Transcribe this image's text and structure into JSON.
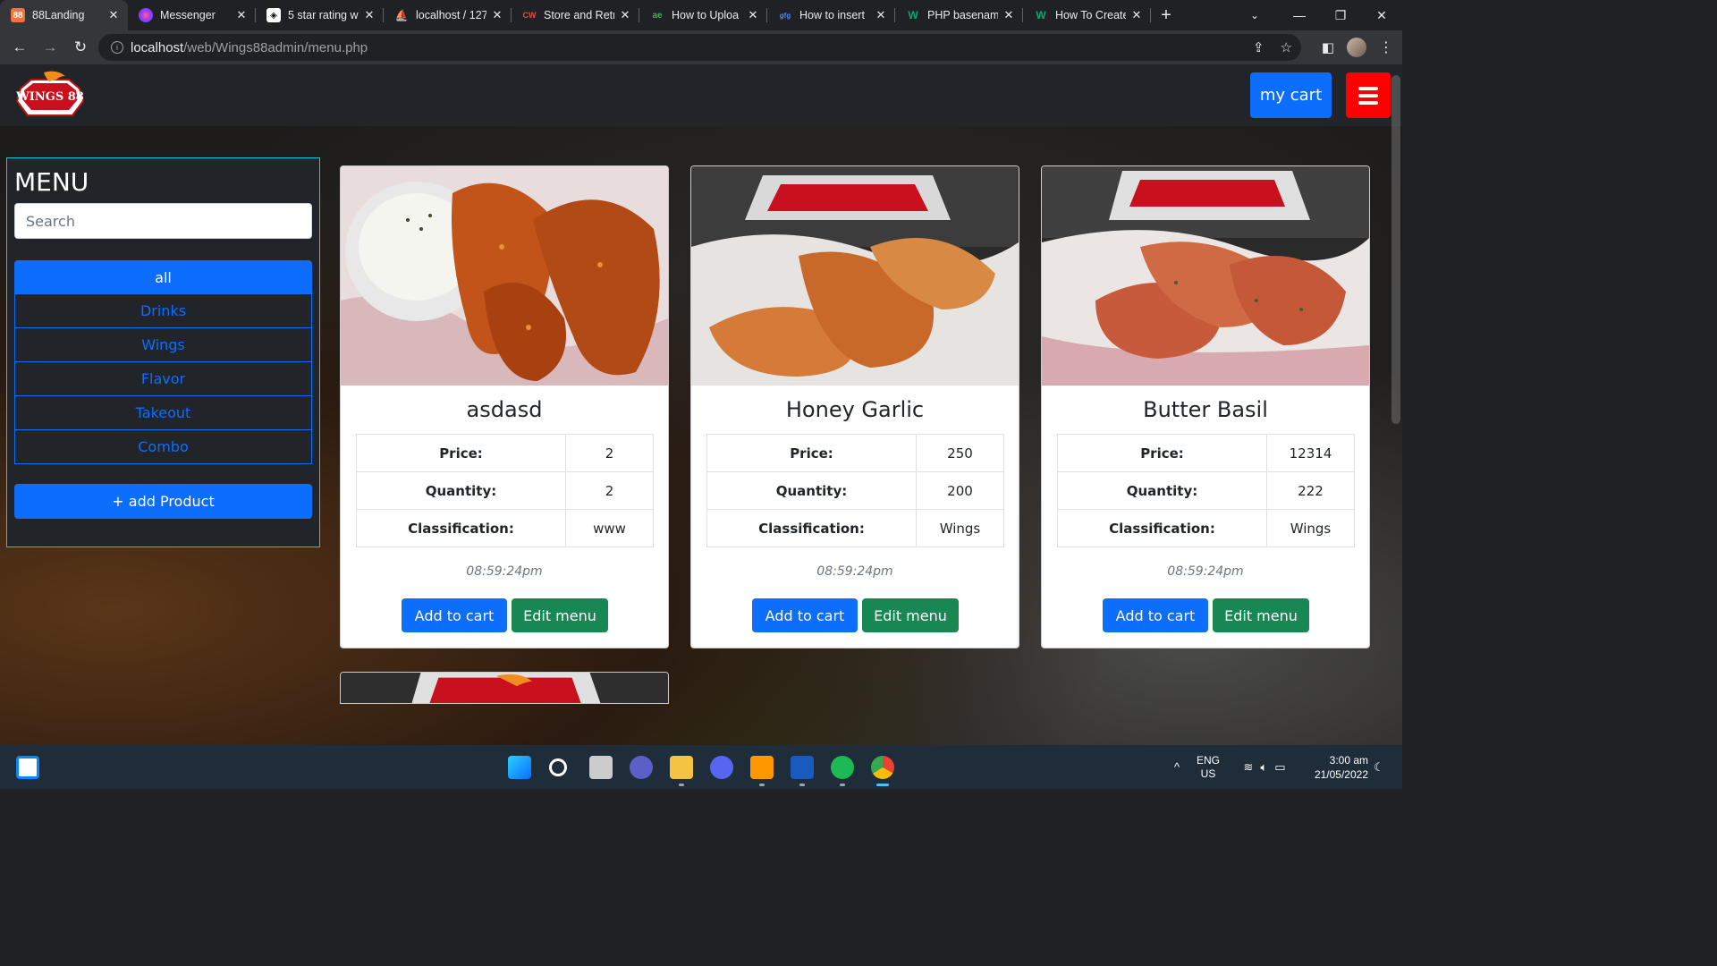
{
  "browser": {
    "tabs": [
      {
        "title": "88Landing",
        "favicon_color": "#f7723a",
        "favicon_glyph": "88",
        "active": true
      },
      {
        "title": "Messenger",
        "favicon_color": "#a033ff",
        "favicon_glyph": "m",
        "active": false
      },
      {
        "title": "5 star rating w",
        "favicon_color": "#ffffff",
        "favicon_glyph": "◈",
        "active": false
      },
      {
        "title": "localhost / 127",
        "favicon_color": "#f7a21b",
        "favicon_glyph": "pma",
        "active": false
      },
      {
        "title": "Store and Retr",
        "favicon_color": "#202124",
        "favicon_glyph": "CW",
        "active": false
      },
      {
        "title": "How to Uploa",
        "favicon_color": "#202124",
        "favicon_glyph": "ae",
        "active": false
      },
      {
        "title": "How to insert",
        "favicon_color": "#202124",
        "favicon_glyph": "gfg",
        "active": false
      },
      {
        "title": "PHP basenam",
        "favicon_color": "#202124",
        "favicon_glyph": "W",
        "active": false
      },
      {
        "title": "How To Create",
        "favicon_color": "#202124",
        "favicon_glyph": "W",
        "active": false
      }
    ],
    "url_host": "localhost",
    "url_path": "/web/Wings88admin/menu.php"
  },
  "navbar": {
    "logo_text": "WINGS 88",
    "cart_label": "my cart"
  },
  "sidebar": {
    "title": "MENU",
    "search_placeholder": "Search",
    "categories": [
      {
        "label": "all",
        "active": true
      },
      {
        "label": "Drinks",
        "active": false
      },
      {
        "label": "Wings",
        "active": false
      },
      {
        "label": "Flavor",
        "active": false
      },
      {
        "label": "Takeout",
        "active": false
      },
      {
        "label": "Combo",
        "active": false
      }
    ],
    "add_product_label": "+ add Product"
  },
  "products": [
    {
      "name": "asdasd",
      "price_label": "Price:",
      "price": "2",
      "quantity_label": "Quantity:",
      "quantity": "2",
      "class_label": "Classification:",
      "classification": "www",
      "time": "08:59:24pm",
      "add_label": "Add to cart",
      "edit_label": "Edit menu"
    },
    {
      "name": "Honey Garlic",
      "price_label": "Price:",
      "price": "250",
      "quantity_label": "Quantity:",
      "quantity": "200",
      "class_label": "Classification:",
      "classification": "Wings",
      "time": "08:59:24pm",
      "add_label": "Add to cart",
      "edit_label": "Edit menu"
    },
    {
      "name": "Butter Basil",
      "price_label": "Price:",
      "price": "12314",
      "quantity_label": "Quantity:",
      "quantity": "222",
      "class_label": "Classification:",
      "classification": "Wings",
      "time": "08:59:24pm",
      "add_label": "Add to cart",
      "edit_label": "Edit menu"
    }
  ],
  "taskbar": {
    "language": "ENG",
    "region": "US",
    "time": "3:00 am",
    "date": "21/05/2022"
  },
  "colors": {
    "primary": "#0d6efd",
    "success": "#198754",
    "danger": "#ff0000",
    "navbar": "#212529",
    "sidebar_border": "#0dcaf0"
  }
}
